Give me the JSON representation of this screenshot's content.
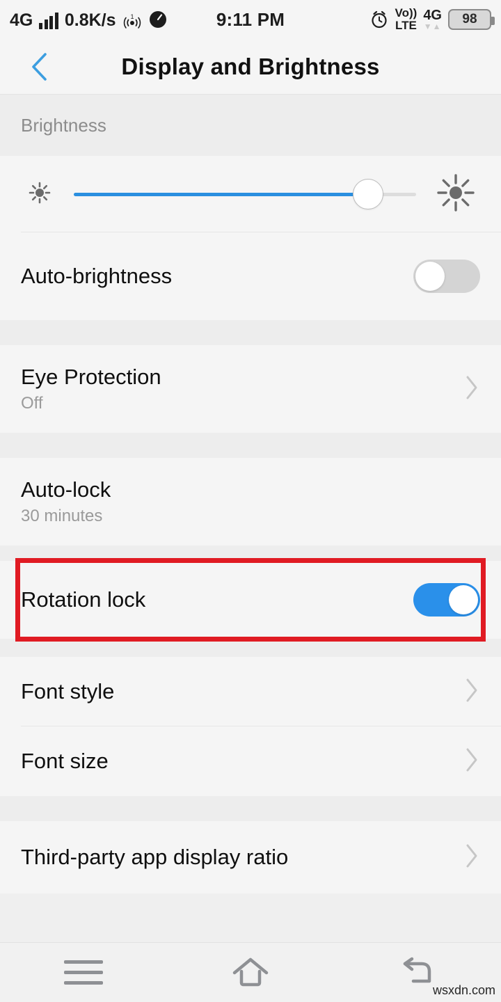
{
  "status_bar": {
    "network_type": "4G",
    "data_speed": "0.8K/s",
    "hotspot_badge": "1",
    "time": "9:11 PM",
    "volte_top": "Vo))",
    "volte_bottom": "LTE",
    "right_network": "4G",
    "battery_level": "98",
    "icons": {
      "signal": "signal-bars-icon",
      "hotspot": "hotspot-icon",
      "speedometer": "speedometer-icon",
      "alarm": "alarm-clock-icon"
    }
  },
  "header": {
    "title": "Display and Brightness",
    "back_icon": "chevron-left-icon",
    "accent_color": "#3c9ee0"
  },
  "sections": {
    "brightness_label": "Brightness",
    "slider": {
      "value_percent": 86,
      "fill_color": "#2a8fe0",
      "low_icon": "sun-small-icon",
      "high_icon": "sun-large-icon"
    },
    "auto_brightness": {
      "title": "Auto-brightness",
      "toggle_state": "off"
    },
    "eye_protection": {
      "title": "Eye Protection",
      "subtitle": "Off",
      "chevron": "chevron-right-icon"
    },
    "auto_lock": {
      "title": "Auto-lock",
      "subtitle": "30 minutes"
    },
    "rotation_lock": {
      "title": "Rotation lock",
      "toggle_state": "on",
      "highlighted": true,
      "highlight_color": "#e01b23"
    },
    "font_style": {
      "title": "Font style",
      "chevron": "chevron-right-icon"
    },
    "font_size": {
      "title": "Font size",
      "chevron": "chevron-right-icon"
    },
    "third_party_ratio": {
      "title": "Third-party app display ratio",
      "chevron": "chevron-right-icon"
    }
  },
  "navbar": {
    "menu_icon": "menu-hamburger-icon",
    "home_icon": "home-icon",
    "back_icon": "back-arrow-icon"
  },
  "watermark": "wsxdn.com"
}
